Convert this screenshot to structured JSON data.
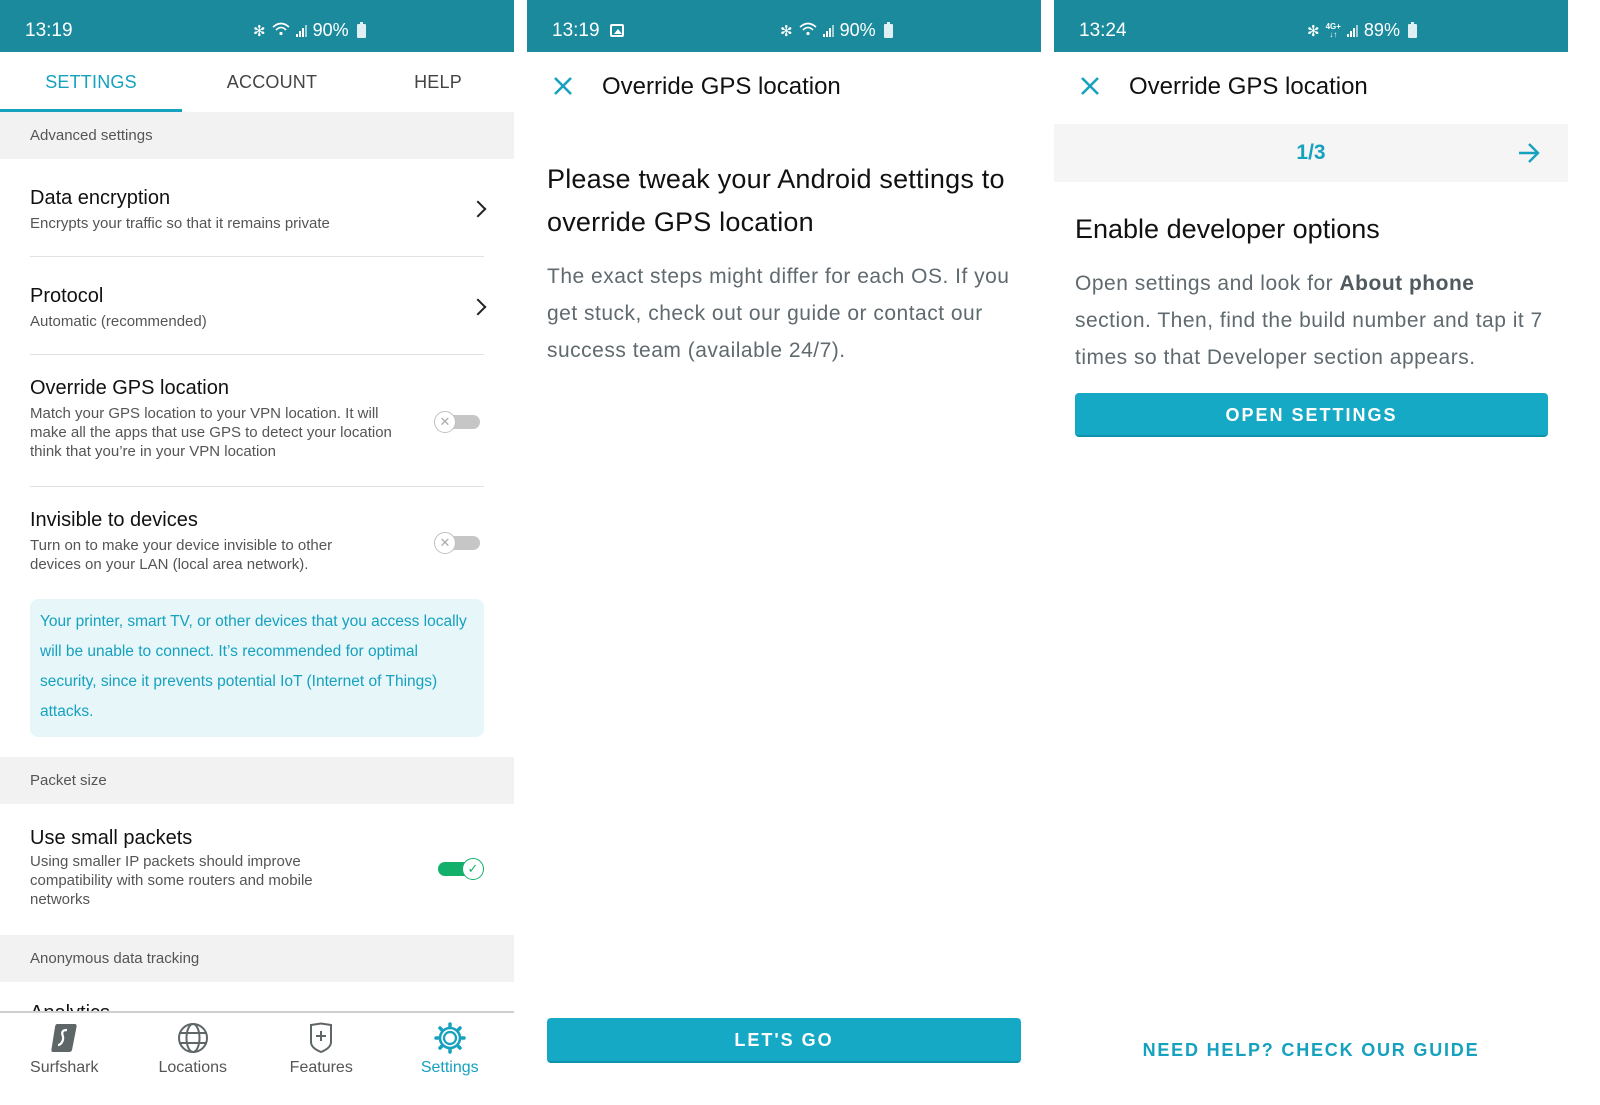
{
  "colors": {
    "status_bar": "#1a8a9c",
    "accent": "#16a1bf",
    "toggle_on": "#12b06b",
    "toggle_off": "#c6c6c6",
    "info_bg": "#e6f6f9",
    "section_bg": "#f2f2f2"
  },
  "screens": [
    {
      "status": {
        "time": "13:19",
        "battery": "90%",
        "icons": [
          "bluetooth-icon",
          "wifi-icon",
          "signal-icon",
          "battery-icon"
        ]
      },
      "tabs": [
        {
          "label": "SETTINGS",
          "active": true
        },
        {
          "label": "ACCOUNT",
          "active": false
        },
        {
          "label": "HELP",
          "active": false
        }
      ],
      "sections": {
        "advanced": "Advanced settings",
        "packet": "Packet size",
        "tracking": "Anonymous data tracking"
      },
      "rows": {
        "encryption": {
          "title": "Data encryption",
          "subtitle": "Encrypts your traffic so that it remains private"
        },
        "protocol": {
          "title": "Protocol",
          "subtitle": "Automatic (recommended)"
        },
        "gps": {
          "title": "Override GPS location",
          "subtitle": "Match your GPS location to your VPN location. It will make all the apps that use GPS to detect your location think that you’re in your VPN location",
          "enabled": false
        },
        "invisible": {
          "title": "Invisible to devices",
          "subtitle": "Turn on to make your device invisible to other devices on your LAN (local area network).",
          "enabled": false
        },
        "invisible_info": "Your printer, smart TV, or other devices that you access locally will be unable to connect. It’s recommended for optimal security, since it prevents potential IoT (Internet of Things) attacks.",
        "small_packets": {
          "title": "Use small packets",
          "subtitle": "Using smaller IP packets should improve compatibility with some routers and mobile networks",
          "enabled": true
        },
        "analytics": {
          "title": "Analytics"
        }
      },
      "bottom_nav": [
        {
          "label": "Surfshark",
          "icon": "surfshark-logo-icon",
          "active": false
        },
        {
          "label": "Locations",
          "icon": "globe-icon",
          "active": false
        },
        {
          "label": "Features",
          "icon": "shield-plus-icon",
          "active": false
        },
        {
          "label": "Settings",
          "icon": "gear-icon",
          "active": true
        }
      ]
    },
    {
      "status": {
        "time": "13:19",
        "battery": "90%",
        "icons": [
          "image-icon",
          "bluetooth-icon",
          "wifi-icon",
          "signal-icon",
          "battery-icon"
        ]
      },
      "title": "Override GPS location",
      "heading": "Please tweak your Android settings to override GPS location",
      "body": "The exact steps might differ for each OS. If you get stuck, check out our guide or contact our success team (available 24/7).",
      "button": "LET'S GO"
    },
    {
      "status": {
        "time": "13:24",
        "battery": "89%",
        "network": "4G+",
        "icons": [
          "bluetooth-icon",
          "lte-icon",
          "signal-icon",
          "battery-icon"
        ]
      },
      "title": "Override GPS location",
      "step": {
        "current": 1,
        "total": 3,
        "label": "1/3"
      },
      "heading": "Enable developer options",
      "body_before": "Open settings and look for ",
      "body_bold": "About phone",
      "body_after": " section. Then, find the build number and tap it 7 times so that Developer section appears.",
      "button": "OPEN SETTINGS",
      "help_link": "NEED HELP? CHECK OUR GUIDE"
    }
  ]
}
